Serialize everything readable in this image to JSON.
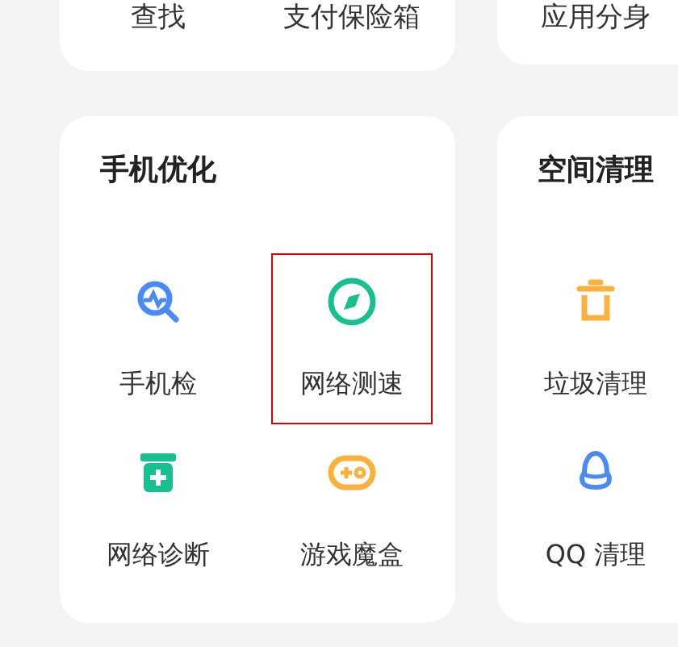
{
  "top_cards": [
    {
      "items": [
        "查找",
        "支付保险箱"
      ]
    },
    {
      "items": [
        "应用分身"
      ]
    }
  ],
  "sections": [
    {
      "title": "手机优化",
      "items": [
        {
          "label": "手机检",
          "kind": "scan",
          "selected": false
        },
        {
          "label": "网络测速",
          "kind": "compass",
          "selected": true
        },
        {
          "label": "网络诊断",
          "kind": "kit",
          "selected": false
        },
        {
          "label": "游戏魔盒",
          "kind": "gamepad",
          "selected": false
        }
      ]
    },
    {
      "title": "空间清理",
      "items": [
        {
          "label": "垃圾清理",
          "kind": "trash",
          "selected": false
        },
        {
          "label": "QQ 清理",
          "kind": "penguin",
          "selected": false
        }
      ]
    }
  ]
}
